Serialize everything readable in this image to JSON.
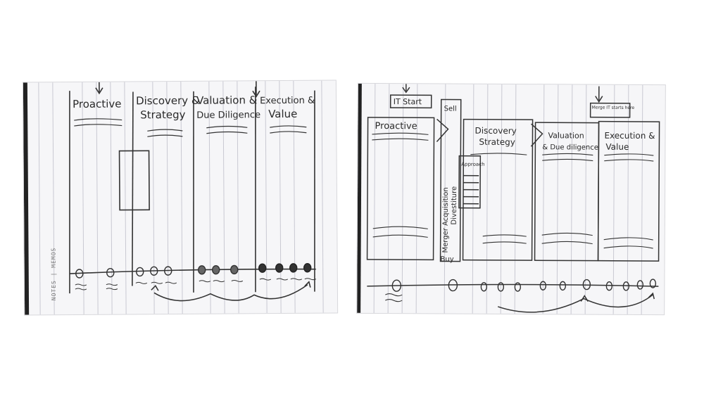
{
  "sketch_left": {
    "phases": [
      "Proactive",
      "Discovery &",
      "Valuation &",
      "Execution &"
    ],
    "phases_line2": [
      "",
      "Strategy",
      "Due Diligence",
      "Value"
    ],
    "side_label": "NOTES | MEMOS"
  },
  "sketch_right": {
    "it_start": "IT Start",
    "merge_start": "Merge IT starts here",
    "sell": "Sell",
    "buy": "Buy",
    "proactive": "Proactive",
    "discovery": "Discovery",
    "discovery2": "Strategy",
    "valuation": "Valuation",
    "valuation2": "& Due diligence",
    "execution": "Execution &",
    "execution2": "Value",
    "merger": "Merger Acquisition",
    "divestiture": "Divestiture",
    "approach": "Approach"
  }
}
